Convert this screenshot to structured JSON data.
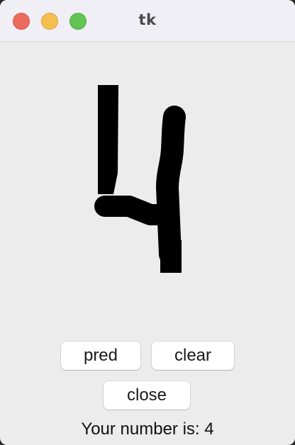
{
  "window": {
    "title": "tk"
  },
  "canvas": {
    "drawn_digit": "4",
    "stroke_color": "#000000"
  },
  "buttons": {
    "pred_label": "pred",
    "clear_label": "clear",
    "close_label": "close"
  },
  "result": {
    "text": "Your number is: 4"
  },
  "colors": {
    "window_bg": "#ececec",
    "titlebar_bg": "#f0eff5",
    "close_dot": "#ed6a5e",
    "minimize_dot": "#f5bf4f",
    "zoom_dot": "#62c554"
  }
}
